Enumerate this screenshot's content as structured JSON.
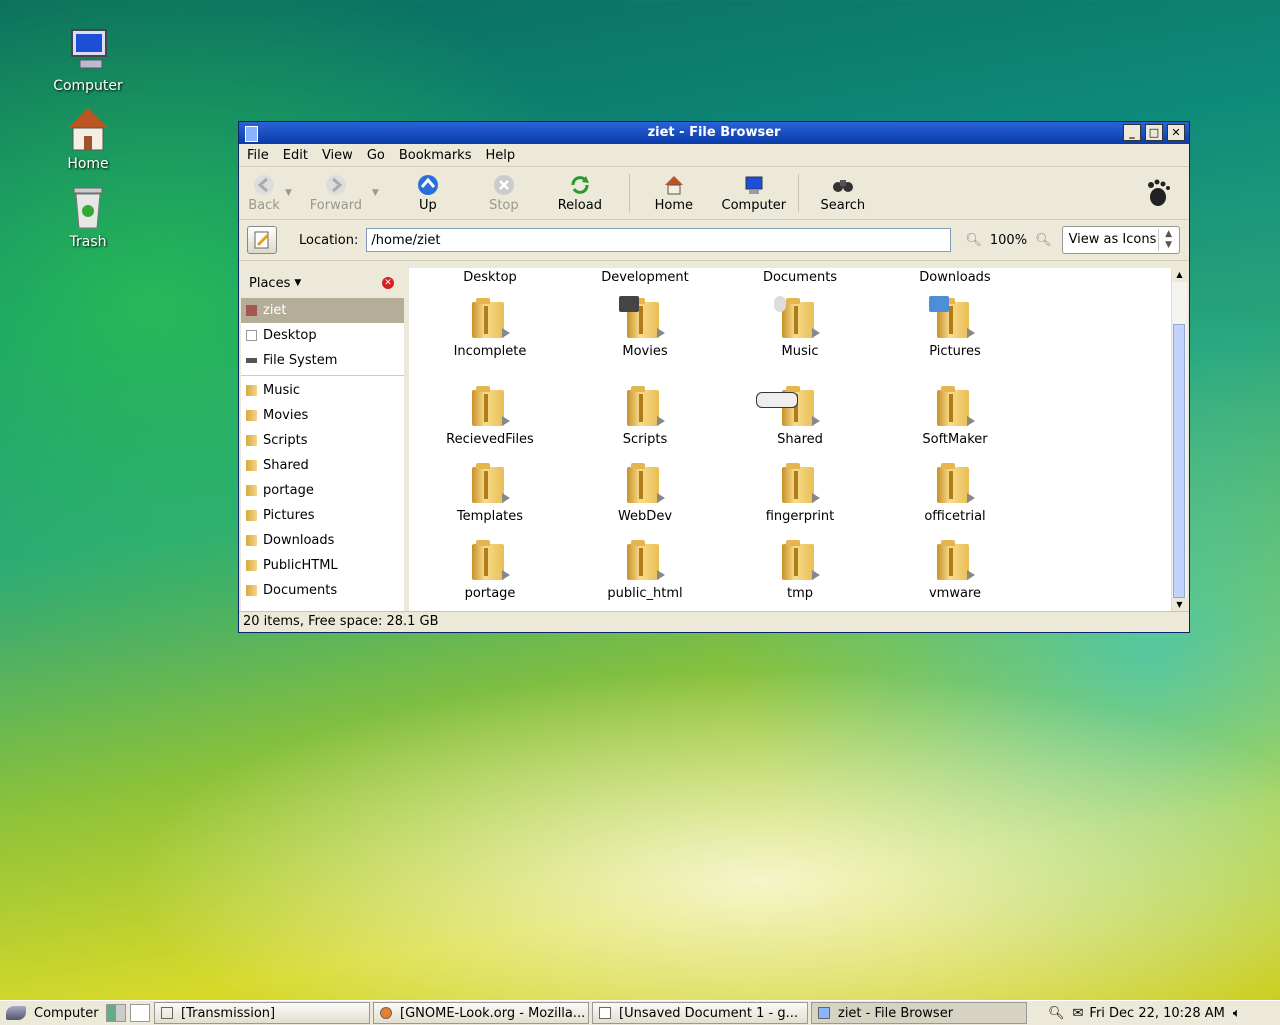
{
  "desktop_icons": [
    {
      "label": "Computer",
      "icon": "computer-icon"
    },
    {
      "label": "Home",
      "icon": "home-icon"
    },
    {
      "label": "Trash",
      "icon": "trash-icon"
    }
  ],
  "window": {
    "title": "ziet - File Browser",
    "menu": [
      "File",
      "Edit",
      "View",
      "Go",
      "Bookmarks",
      "Help"
    ],
    "toolbar": {
      "back": "Back",
      "forward": "Forward",
      "up": "Up",
      "stop": "Stop",
      "reload": "Reload",
      "home": "Home",
      "computer": "Computer",
      "search": "Search"
    },
    "location": {
      "label": "Location:",
      "value": "/home/ziet"
    },
    "zoom": "100%",
    "view_mode": "View as Icons",
    "sidebar": {
      "header": "Places",
      "items_top": [
        "ziet",
        "Desktop",
        "File System"
      ],
      "items_bookmarks": [
        "Music",
        "Movies",
        "Scripts",
        "Shared",
        "portage",
        "Pictures",
        "Downloads",
        "PublicHTML",
        "Documents"
      ]
    },
    "top_row_labels": [
      "Desktop",
      "Development",
      "Documents",
      "Downloads"
    ],
    "files": [
      "Incomplete",
      "Movies",
      "Music",
      "Pictures",
      "RecievedFiles",
      "Scripts",
      "Shared",
      "SoftMaker",
      "Templates",
      "WebDev",
      "fingerprint",
      "officetrial",
      "portage",
      "public_html",
      "tmp",
      "vmware"
    ],
    "status": "20 items, Free space: 28.1 GB"
  },
  "taskbar": {
    "start_label": "Computer",
    "tasks": [
      "[Transmission]",
      "[GNOME-Look.org - Mozilla...",
      "[Unsaved Document 1 - g...",
      "ziet - File Browser"
    ],
    "clock": "Fri Dec 22, 10:28 AM"
  }
}
